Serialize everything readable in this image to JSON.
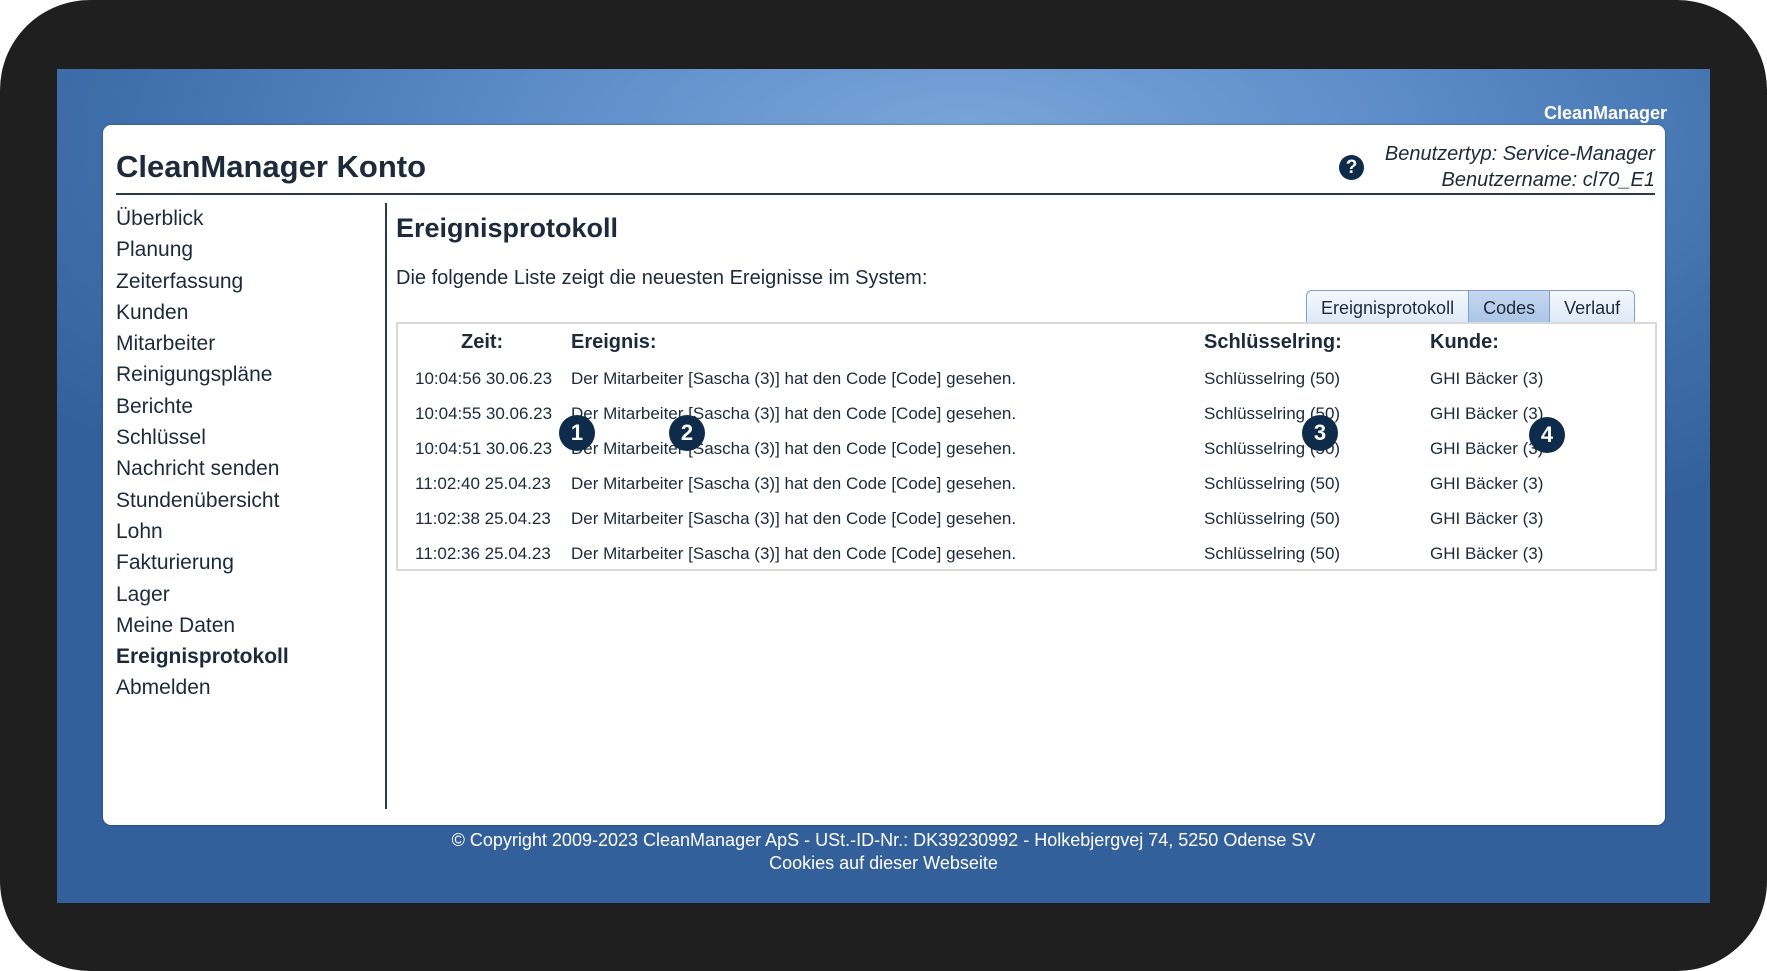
{
  "brand": "CleanManager",
  "header": {
    "title": "CleanManager Konto",
    "help_icon": "?",
    "user_type": "Benutzertyp: Service-Manager",
    "user_name": "Benutzername: cl70_E1"
  },
  "sidebar": {
    "items": [
      {
        "label": "Überblick"
      },
      {
        "label": "Planung"
      },
      {
        "label": "Zeiterfassung"
      },
      {
        "label": "Kunden"
      },
      {
        "label": "Mitarbeiter"
      },
      {
        "label": "Reinigungspläne"
      },
      {
        "label": "Berichte"
      },
      {
        "label": "Schlüssel"
      },
      {
        "label": "Nachricht senden"
      },
      {
        "label": "Stundenübersicht"
      },
      {
        "label": "Lohn"
      },
      {
        "label": "Fakturierung"
      },
      {
        "label": "Lager"
      },
      {
        "label": "Meine Daten"
      },
      {
        "label": "Ereignisprotokoll",
        "active": true
      },
      {
        "label": "Abmelden"
      }
    ]
  },
  "main": {
    "title": "Ereignisprotokoll",
    "intro": "Die folgende Liste zeigt die neuesten Ereignisse im System:",
    "tabs": [
      {
        "label": "Ereignisprotokoll"
      },
      {
        "label": "Codes",
        "active": true
      },
      {
        "label": "Verlauf"
      }
    ],
    "table": {
      "headers": [
        "Zeit:",
        "Ereignis:",
        "Schlüsselring:",
        "Kunde:"
      ],
      "rows": [
        [
          "10:04:56 30.06.23",
          "Der Mitarbeiter [Sascha (3)] hat den Code [Code] gesehen.",
          "Schlüsselring (50)",
          "GHI Bäcker (3)"
        ],
        [
          "10:04:55 30.06.23",
          "Der Mitarbeiter [Sascha (3)] hat den Code [Code] gesehen.",
          "Schlüsselring (50)",
          "GHI Bäcker (3)"
        ],
        [
          "10:04:51 30.06.23",
          "Der Mitarbeiter [Sascha (3)] hat den Code [Code] gesehen.",
          "Schlüsselring (50)",
          "GHI Bäcker (3)"
        ],
        [
          "11:02:40 25.04.23",
          "Der Mitarbeiter [Sascha (3)] hat den Code [Code] gesehen.",
          "Schlüsselring (50)",
          "GHI Bäcker (3)"
        ],
        [
          "11:02:38 25.04.23",
          "Der Mitarbeiter [Sascha (3)] hat den Code [Code] gesehen.",
          "Schlüsselring (50)",
          "GHI Bäcker (3)"
        ],
        [
          "11:02:36 25.04.23",
          "Der Mitarbeiter [Sascha (3)] hat den Code [Code] gesehen.",
          "Schlüsselring (50)",
          "GHI Bäcker (3)"
        ]
      ]
    }
  },
  "callouts": [
    "1",
    "2",
    "3",
    "4"
  ],
  "footer": {
    "copyright": "© Copyright 2009-2023 CleanManager ApS - USt.-ID-Nr.: DK39230992 - Holkebjergvej 74, 5250 Odense SV",
    "cookies": "Cookies auf dieser Webseite"
  }
}
